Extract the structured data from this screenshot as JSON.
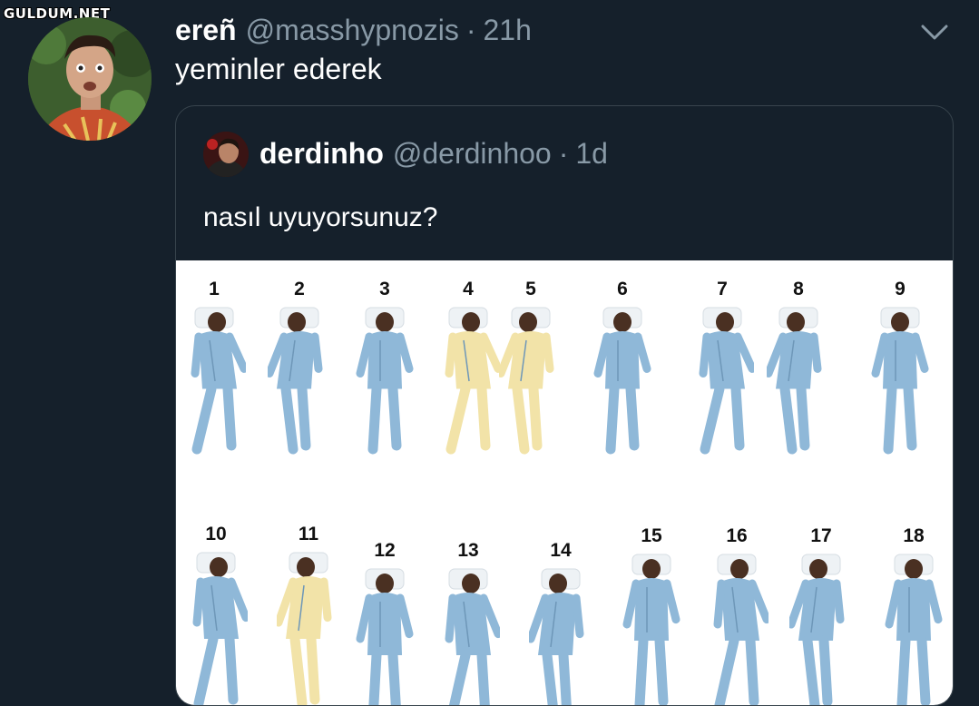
{
  "watermark": "GULDUM.NET",
  "tweet": {
    "name": "ereñ",
    "handle": "@masshypnozis",
    "separator": "·",
    "time": "21h",
    "text": "yeminler ederek"
  },
  "quoted": {
    "name": "derdinho",
    "handle": "@derdinhoo",
    "separator": "·",
    "time": "1d",
    "text": "nasıl uyuyorsunuz?"
  },
  "sleep_positions": {
    "numbers": [
      "1",
      "2",
      "3",
      "4",
      "5",
      "6",
      "7",
      "8",
      "9",
      "10",
      "11",
      "12",
      "13",
      "14",
      "15",
      "16",
      "17",
      "18"
    ]
  },
  "colors": {
    "background": "#15202b",
    "muted": "#8899a6",
    "border": "#38444d",
    "pajama": "#8fb8d8",
    "nightgown": "#f2e3a8"
  }
}
